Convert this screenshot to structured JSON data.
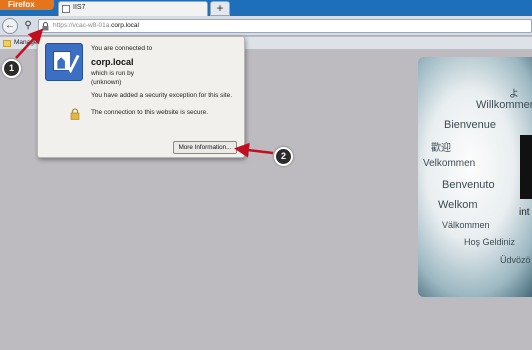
{
  "browser": {
    "menu_label": "Firefox",
    "tab_title": "IIS7",
    "new_tab_label": "+",
    "back_icon": "back-arrow-icon",
    "url_prefix": "https://vcac-w8-01a.",
    "url_domain": "corp.local",
    "bookmark_label": "Manage"
  },
  "identity_popup": {
    "connected_label": "You are connected to",
    "host": "corp.local",
    "run_by_label": "which is run by",
    "owner": "(unknown)",
    "exception_text": "You have added a security exception for this site.",
    "secure_text": "The connection to this website is secure.",
    "more_info_button": "More Information..."
  },
  "welcome_words": [
    "よ",
    "Willkommen",
    "Bienvenue",
    "歡迎",
    "Velkommen",
    "Benvenuto",
    "Welkom",
    "int",
    "Välkommen",
    "Hoş Geldiniz",
    "Üdvözö"
  ],
  "annotations": [
    {
      "number": "1"
    },
    {
      "number": "2"
    }
  ],
  "colors": {
    "annotation_arrow": "#c0101f",
    "tab_bar": "#1c6fb8",
    "firefox_button": "#e6741a"
  }
}
